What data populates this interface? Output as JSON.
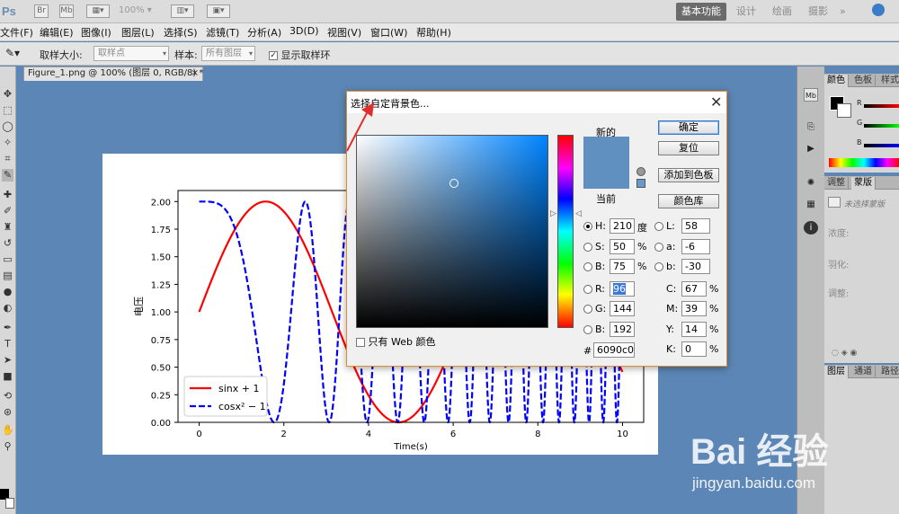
{
  "app": {
    "logo": "Ps",
    "zoom": "100%",
    "workspaces": [
      "基本功能",
      "设计",
      "绘画",
      "摄影"
    ],
    "overflow": "»"
  },
  "menu": [
    "文件(F)",
    "编辑(E)",
    "图像(I)",
    "图层(L)",
    "选择(S)",
    "滤镜(T)",
    "分析(A)",
    "3D(D)",
    "视图(V)",
    "窗口(W)",
    "帮助(H)"
  ],
  "options": {
    "sample_size_label": "取样大小:",
    "sample_size_value": "取样点",
    "sample_label": "样本:",
    "sample_value": "所有图层",
    "show_ring_label": "显示取样环"
  },
  "document": {
    "tab_title": "Figure_1.png @ 100% (图层 0, RGB/8) *",
    "close": "×"
  },
  "panels": {
    "top_tabs": [
      "颜色",
      "色板",
      "样式"
    ],
    "color_labels": [
      "R",
      "G",
      "B"
    ],
    "adjust_tabs": [
      "调整",
      "蒙版"
    ],
    "mask_text": "未选择蒙版",
    "mask_rows": [
      "浓度:",
      "羽化:",
      "调整:"
    ],
    "bottom_tabs": [
      "图层",
      "通道",
      "路径"
    ]
  },
  "dialog": {
    "title": "选择自定背景色...",
    "new_label": "新的",
    "current_label": "当前",
    "ok": "确定",
    "reset": "复位",
    "add_swatch": "添加到色板",
    "color_libraries": "颜色库",
    "web_only": "只有 Web 颜色",
    "hash": "#",
    "hex": "6090c0",
    "swatch_color": "#6090c0",
    "hsb": [
      {
        "key": "H:",
        "value": "210",
        "unit": "度"
      },
      {
        "key": "S:",
        "value": "50",
        "unit": "%"
      },
      {
        "key": "B:",
        "value": "75",
        "unit": "%"
      }
    ],
    "lab": [
      {
        "key": "L:",
        "value": "58"
      },
      {
        "key": "a:",
        "value": "-6"
      },
      {
        "key": "b:",
        "value": "-30"
      }
    ],
    "rgb": [
      {
        "key": "R:",
        "value": "96"
      },
      {
        "key": "G:",
        "value": "144"
      },
      {
        "key": "B:",
        "value": "192"
      }
    ],
    "cmyk": [
      {
        "key": "C:",
        "value": "67",
        "unit": "%"
      },
      {
        "key": "M:",
        "value": "39",
        "unit": "%"
      },
      {
        "key": "Y:",
        "value": "14",
        "unit": "%"
      },
      {
        "key": "K:",
        "value": "0",
        "unit": "%"
      }
    ]
  },
  "chart_data": {
    "type": "line",
    "ylabel": "电压",
    "xlabel": "Time(s)",
    "xlim": [
      -0.5,
      10.5
    ],
    "ylim": [
      0,
      2.1
    ],
    "xticks": [
      "0",
      "2",
      "4",
      "6",
      "8",
      "10"
    ],
    "yticks": [
      "0.00",
      "0.25",
      "0.50",
      "0.75",
      "1.00",
      "1.25",
      "1.50",
      "1.75",
      "2.00"
    ],
    "series": [
      {
        "name": "sinx + 1",
        "formula": "sin(x)+1",
        "color": "#ff0000",
        "style": "solid"
      },
      {
        "name": "cosx² − 1",
        "formula": "cos(x^2)+1",
        "color": "#0000ff",
        "style": "dashed"
      }
    ],
    "legend": "lower-left"
  },
  "watermark": {
    "main": "Bai 经验",
    "sub": "jingyan.baidu.com"
  }
}
